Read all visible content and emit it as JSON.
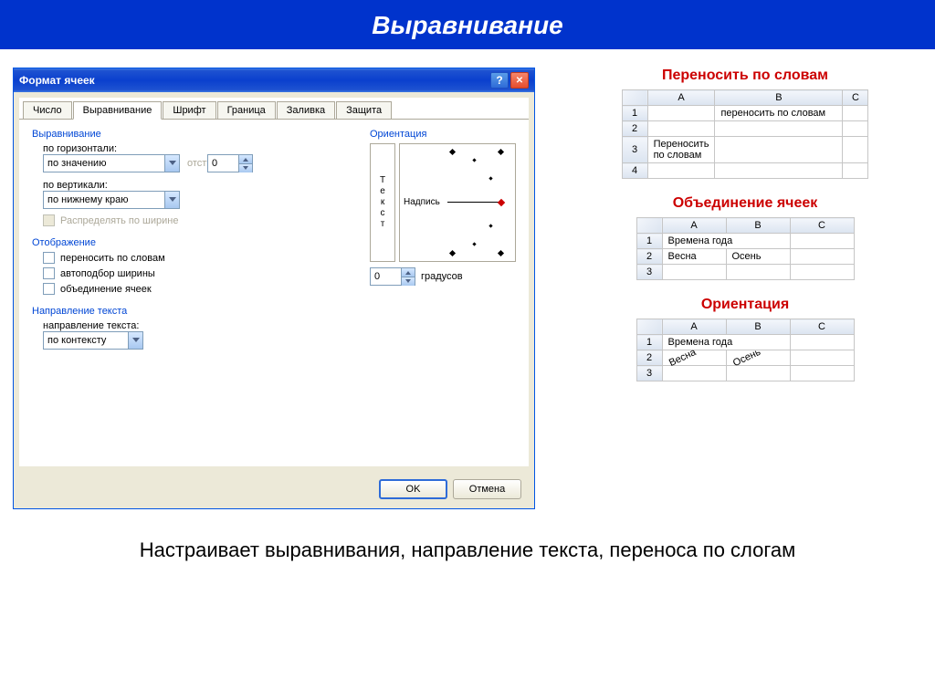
{
  "slide": {
    "title": "Выравнивание"
  },
  "dialog": {
    "title": "Формат ячеек",
    "tabs": [
      "Число",
      "Выравнивание",
      "Шрифт",
      "Граница",
      "Заливка",
      "Защита"
    ],
    "active_tab": 1,
    "alignment": {
      "title": "Выравнивание",
      "h_label": "по горизонтали:",
      "h_value": "по значению",
      "indent_label": "отступ:",
      "indent_value": "0",
      "v_label": "по вертикали:",
      "v_value": "по нижнему краю",
      "distribute": "Распределять по ширине"
    },
    "display": {
      "title": "Отображение",
      "wrap": "переносить по словам",
      "shrink": "автоподбор ширины",
      "merge": "объединение ячеек"
    },
    "direction": {
      "title": "Направление текста",
      "label": "направление текста:",
      "value": "по контексту"
    },
    "orientation": {
      "title": "Ориентация",
      "vertical_text": "Текст",
      "label_text": "Надпись",
      "degrees_value": "0",
      "degrees_label": "градусов"
    },
    "ok": "OK",
    "cancel": "Отмена"
  },
  "examples": {
    "wrap": {
      "title": "Переносить по словам",
      "cols": [
        "A",
        "B",
        "C"
      ],
      "b1": "переносить по словам",
      "a3_line1": "Переносить",
      "a3_line2": "по словам"
    },
    "merge": {
      "title": "Объединение ячеек",
      "cols": [
        "A",
        "B",
        "C"
      ],
      "r1": "Времена года",
      "a2": "Весна",
      "b2": "Осень"
    },
    "orient": {
      "title": "Ориентация",
      "cols": [
        "A",
        "B",
        "C"
      ],
      "r1": "Времена года",
      "a2": "Весна",
      "b2": "Осень"
    }
  },
  "caption": "Настраивает выравнивания, направление текста, переноса по слогам"
}
